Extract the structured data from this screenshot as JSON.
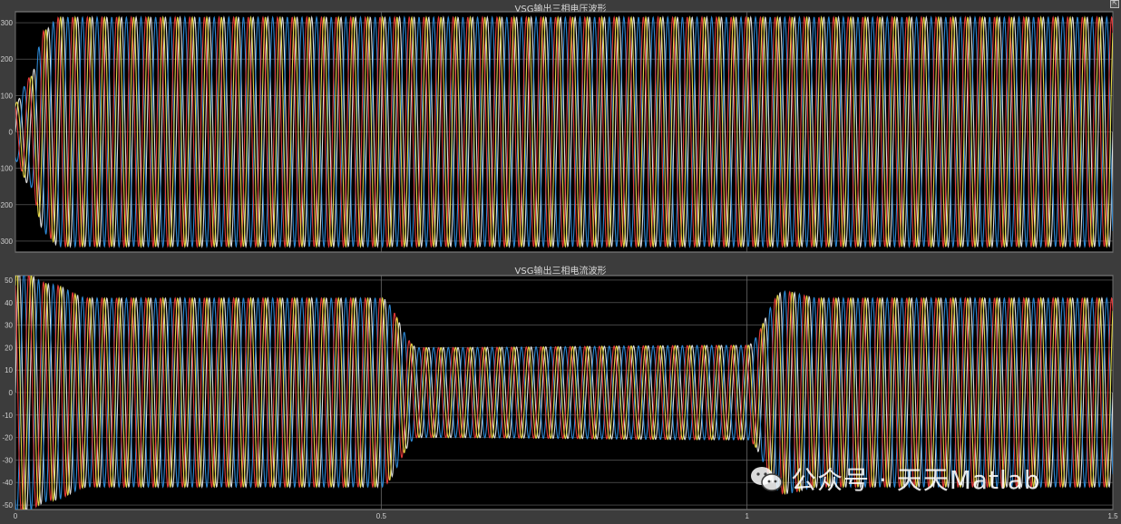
{
  "chart_data": [
    {
      "type": "line",
      "title": "VSG输出三相电压波形",
      "x_range": [
        0,
        1.5
      ],
      "ylim": [
        -330,
        330
      ],
      "yticks": [
        -300,
        -200,
        -100,
        0,
        100,
        200,
        300
      ],
      "ytick_labels": [
        "-300",
        "-200",
        "-100",
        "0",
        "100",
        "200",
        "300"
      ],
      "xticks": [
        0,
        0.5,
        1,
        1.5
      ],
      "grid": true,
      "frequency_hz": 50,
      "amplitude_envelope": [
        {
          "t": 0,
          "amplitude": 80
        },
        {
          "t": 0.02,
          "amplitude": 150
        },
        {
          "t": 0.04,
          "amplitude": 280
        },
        {
          "t": 0.06,
          "amplitude": 315
        },
        {
          "t": 1.5,
          "amplitude": 315
        }
      ],
      "series": [
        {
          "phase_deg": 0,
          "color": "#e8e8e8"
        },
        {
          "phase_deg": -120,
          "color": "#2f8fdf"
        },
        {
          "phase_deg": 120,
          "color": "#ee3b3b"
        },
        {
          "phase_deg": 60,
          "color": "#f0e24a"
        }
      ]
    },
    {
      "type": "line",
      "title": "VSG输出三相电流波形",
      "x_range": [
        0,
        1.5
      ],
      "ylim": [
        -52,
        52
      ],
      "yticks": [
        -50,
        -40,
        -30,
        -20,
        -10,
        0,
        10,
        20,
        30,
        40,
        50
      ],
      "ytick_labels": [
        "-50",
        "-40",
        "-30",
        "-20",
        "-10",
        "0",
        "10",
        "20",
        "30",
        "40",
        "50"
      ],
      "xticks": [
        0,
        0.5,
        1,
        1.5
      ],
      "xtick_labels": [
        "0",
        "0.5",
        "1",
        "1.5"
      ],
      "grid": true,
      "frequency_hz": 50,
      "amplitude_envelope": [
        {
          "t": 0,
          "amplitude": 55
        },
        {
          "t": 0.05,
          "amplitude": 48
        },
        {
          "t": 0.1,
          "amplitude": 42
        },
        {
          "t": 0.5,
          "amplitude": 42
        },
        {
          "t": 0.55,
          "amplitude": 20
        },
        {
          "t": 1.0,
          "amplitude": 21
        },
        {
          "t": 1.05,
          "amplitude": 45
        },
        {
          "t": 1.1,
          "amplitude": 42
        },
        {
          "t": 1.5,
          "amplitude": 42
        }
      ],
      "series": [
        {
          "phase_deg": 0,
          "color": "#e8e8e8"
        },
        {
          "phase_deg": -120,
          "color": "#2f8fdf"
        },
        {
          "phase_deg": 120,
          "color": "#ee3b3b"
        },
        {
          "phase_deg": 60,
          "color": "#f0e24a"
        }
      ]
    }
  ],
  "watermark": {
    "text": "公众号 · 天天Matlab"
  },
  "colors": {
    "frame_bg": "#3c3c3c",
    "plot_bg": "#000000",
    "grid": "#6a6a6a",
    "axis_text": "#cfcfcf"
  }
}
